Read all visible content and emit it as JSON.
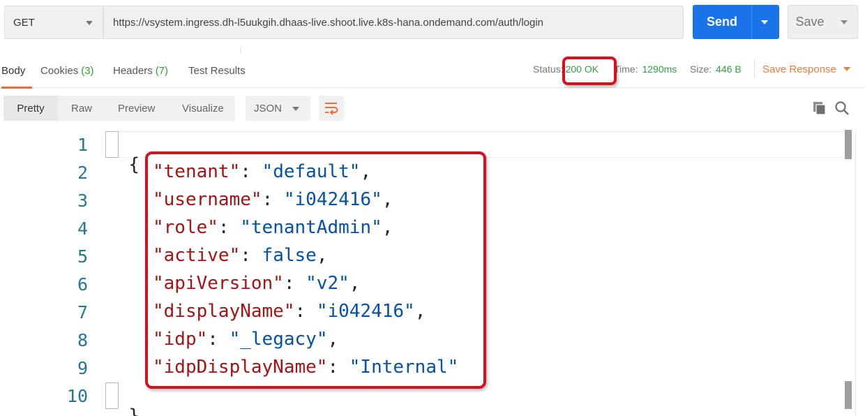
{
  "request": {
    "method": "GET",
    "url": "https://vsystem.ingress.dh-l5uukgih.dhaas-live.shoot.live.k8s-hana.ondemand.com/auth/login",
    "send_label": "Send",
    "save_label": "Save"
  },
  "response_tabs": [
    {
      "label": "Body",
      "count": ""
    },
    {
      "label": "Cookies",
      "count": "(3)"
    },
    {
      "label": "Headers",
      "count": "(7)"
    },
    {
      "label": "Test Results",
      "count": ""
    }
  ],
  "response_meta": {
    "status_label": "Status:",
    "status_value": "200 OK",
    "time_label": "Time:",
    "time_value": "1290ms",
    "size_label": "Size:",
    "size_value": "446 B",
    "save_response_label": "Save Response"
  },
  "format": {
    "modes": [
      "Pretty",
      "Raw",
      "Preview",
      "Visualize"
    ],
    "selected_mode": "Pretty",
    "language": "JSON"
  },
  "code": {
    "line_numbers": [
      "1",
      "2",
      "3",
      "4",
      "5",
      "6",
      "7",
      "8",
      "9",
      "10"
    ],
    "open_brace": "{",
    "close_brace": "}",
    "fields": [
      {
        "key": "\"tenant\"",
        "value": "\"default\"",
        "trail": ","
      },
      {
        "key": "\"username\"",
        "value": "\"i042416\"",
        "trail": ","
      },
      {
        "key": "\"role\"",
        "value": "\"tenantAdmin\"",
        "trail": ","
      },
      {
        "key": "\"active\"",
        "value": "false",
        "trail": ","
      },
      {
        "key": "\"apiVersion\"",
        "value": "\"v2\"",
        "trail": ","
      },
      {
        "key": "\"displayName\"",
        "value": "\"i042416\"",
        "trail": ","
      },
      {
        "key": "\"idp\"",
        "value": "\"_legacy\"",
        "trail": ","
      },
      {
        "key": "\"idpDisplayName\"",
        "value": "\"Internal\"",
        "trail": ""
      }
    ]
  },
  "colors": {
    "accent_send": "#1a73e8",
    "tab_underline": "#f26b3a",
    "status_ok": "#2fa043",
    "save_response": "#f07d3a",
    "json_key": "#a31515",
    "json_value": "#0451a5",
    "highlight_box": "#d9101b"
  },
  "icons": {
    "wrap": "wrap-lines-icon",
    "copy": "copy-icon",
    "search": "search-icon"
  }
}
